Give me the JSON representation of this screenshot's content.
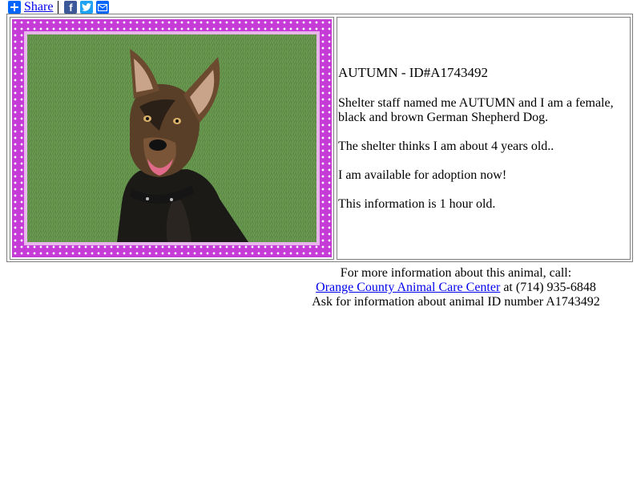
{
  "share": {
    "label": "Share",
    "icons": [
      "plus-icon",
      "facebook-icon",
      "twitter-icon",
      "email-icon"
    ],
    "colors": {
      "plus": "#0166ff",
      "facebook": "#3b5998",
      "twitter": "#1da1f2",
      "email": "#0166ff"
    }
  },
  "pet": {
    "title": "AUTUMN - ID#A1743492",
    "description": "Shelter staff named me AUTUMN and I am a female, black and brown German Shepherd Dog.",
    "age": "The shelter thinks I am about 4 years old..",
    "availability": "I am available for adoption now!",
    "freshness": "This information is 1 hour old.",
    "photo_frame_color": "#c43bd6"
  },
  "contact": {
    "line1": "For more information about this animal, call:",
    "shelter_name": "Orange County Animal Care Center",
    "phone_text": " at (714) 935-6848",
    "line3": "Ask for information about animal ID number A1743492"
  }
}
